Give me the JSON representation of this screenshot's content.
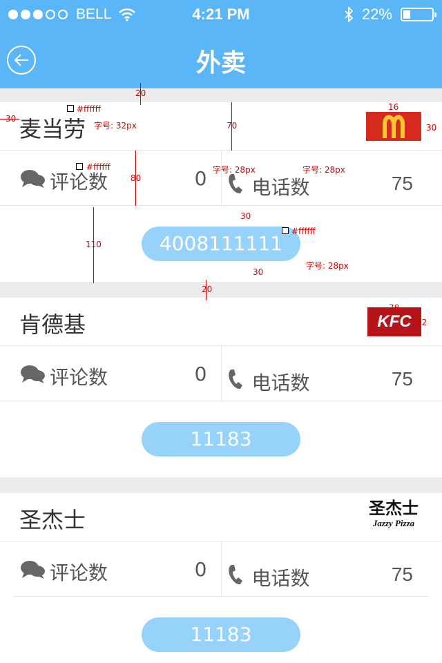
{
  "status": {
    "carrier": "BELL",
    "time": "4:21 PM",
    "battery": "22%",
    "signal_dots_on": 3,
    "signal_dots_total": 5,
    "battery_level": 0.22
  },
  "nav": {
    "title": "外卖"
  },
  "labels": {
    "comments": "评论数",
    "phone": "电话数"
  },
  "restaurants": [
    {
      "name": "麦当劳",
      "comments": "0",
      "calls": "75",
      "phone_number": "4008111111",
      "logo": "mcdonalds-logo"
    },
    {
      "name": "肯德基",
      "comments": "0",
      "calls": "75",
      "phone_number": "11183",
      "logo": "kfc-logo",
      "logo_text": "KFC"
    },
    {
      "name": "圣杰士",
      "comments": "0",
      "calls": "75",
      "phone_number": "11183",
      "logo": "jazzy-pizza-logo",
      "logo_text": "圣杰士",
      "logo_subtext": "Jazzy Pizza"
    }
  ],
  "annotations": {
    "white_hex": "#ffffff",
    "font32": "字号: 32px",
    "font28": "字号: 28px",
    "n20": "20",
    "n30": "30",
    "n70": "70",
    "n80": "80",
    "n110": "110",
    "n16": "16",
    "n78": "78",
    "n42": "42"
  },
  "colors": {
    "nav_bg": "#5bb6f7",
    "button_bg": "#97d2fb",
    "mcd_red": "#d52b1e",
    "mcd_yellow": "#ffc72c",
    "kfc_red": "#b7141a"
  }
}
